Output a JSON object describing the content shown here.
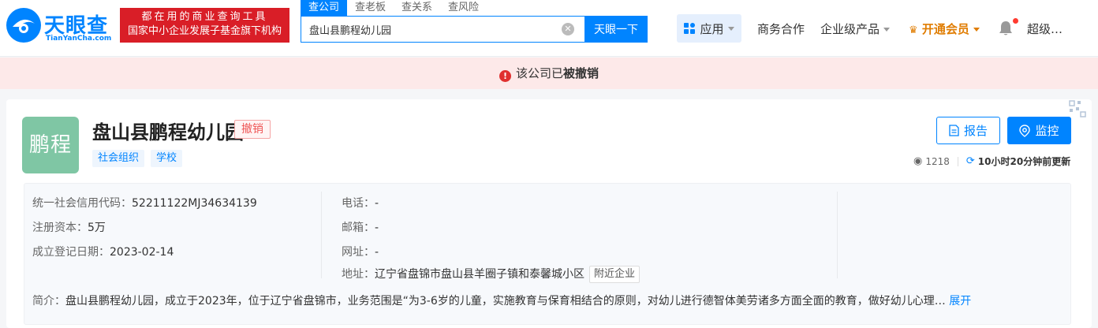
{
  "brand": {
    "name": "天眼查",
    "domain": "TianYanCha.com",
    "slogan_line1": "都在用的商业查询工具",
    "slogan_line2": "国家中小企业发展子基金旗下机构",
    "colors": {
      "primary": "#0084ff",
      "slogan_bg": "#d91e27"
    }
  },
  "search": {
    "tabs": [
      "查公司",
      "查老板",
      "查关系",
      "查风险"
    ],
    "active_tab": "查公司",
    "value": "盘山县鹏程幼儿园",
    "button": "天眼一下",
    "clear_icon": "clear-icon"
  },
  "nav": {
    "apps": "应用",
    "business": "商务合作",
    "enterprise": "企业级产品",
    "vip": "开通会员",
    "user": "超级…"
  },
  "banner": {
    "text_prefix": "该公司已",
    "text_bold": "被撤销",
    "icon": "warning-icon"
  },
  "company": {
    "avatar_text": "鹏程",
    "name": "盘山县鹏程幼儿园",
    "status": "撤销",
    "tags": [
      "社会组织",
      "学校"
    ],
    "report_label": "报告",
    "monitor_label": "监控",
    "views": "1218",
    "updated": "10小时20分钟前更新"
  },
  "info": {
    "credit_code_label": "统一社会信用代码：",
    "credit_code": "52211122MJ34634139",
    "capital_label": "注册资本：",
    "capital": "5万",
    "founded_label": "成立登记日期：",
    "founded": "2023-02-14",
    "phone_label": "电话：",
    "phone": "-",
    "email_label": "邮箱：",
    "email": "-",
    "website_label": "网址：",
    "website": "-",
    "address_label": "地址：",
    "address": "辽宁省盘锦市盘山县羊圈子镇和泰馨城小区",
    "nearby_label": "附近企业",
    "intro_label": "简介：",
    "intro": "盘山县鹏程幼儿园，成立于2023年，位于辽宁省盘锦市，业务范围是“为3-6岁的儿童，实施教育与保育相结合的原则，对幼儿进行德智体美劳诸多方面全面的教育，做好幼儿心理…",
    "expand_label": "展开"
  }
}
